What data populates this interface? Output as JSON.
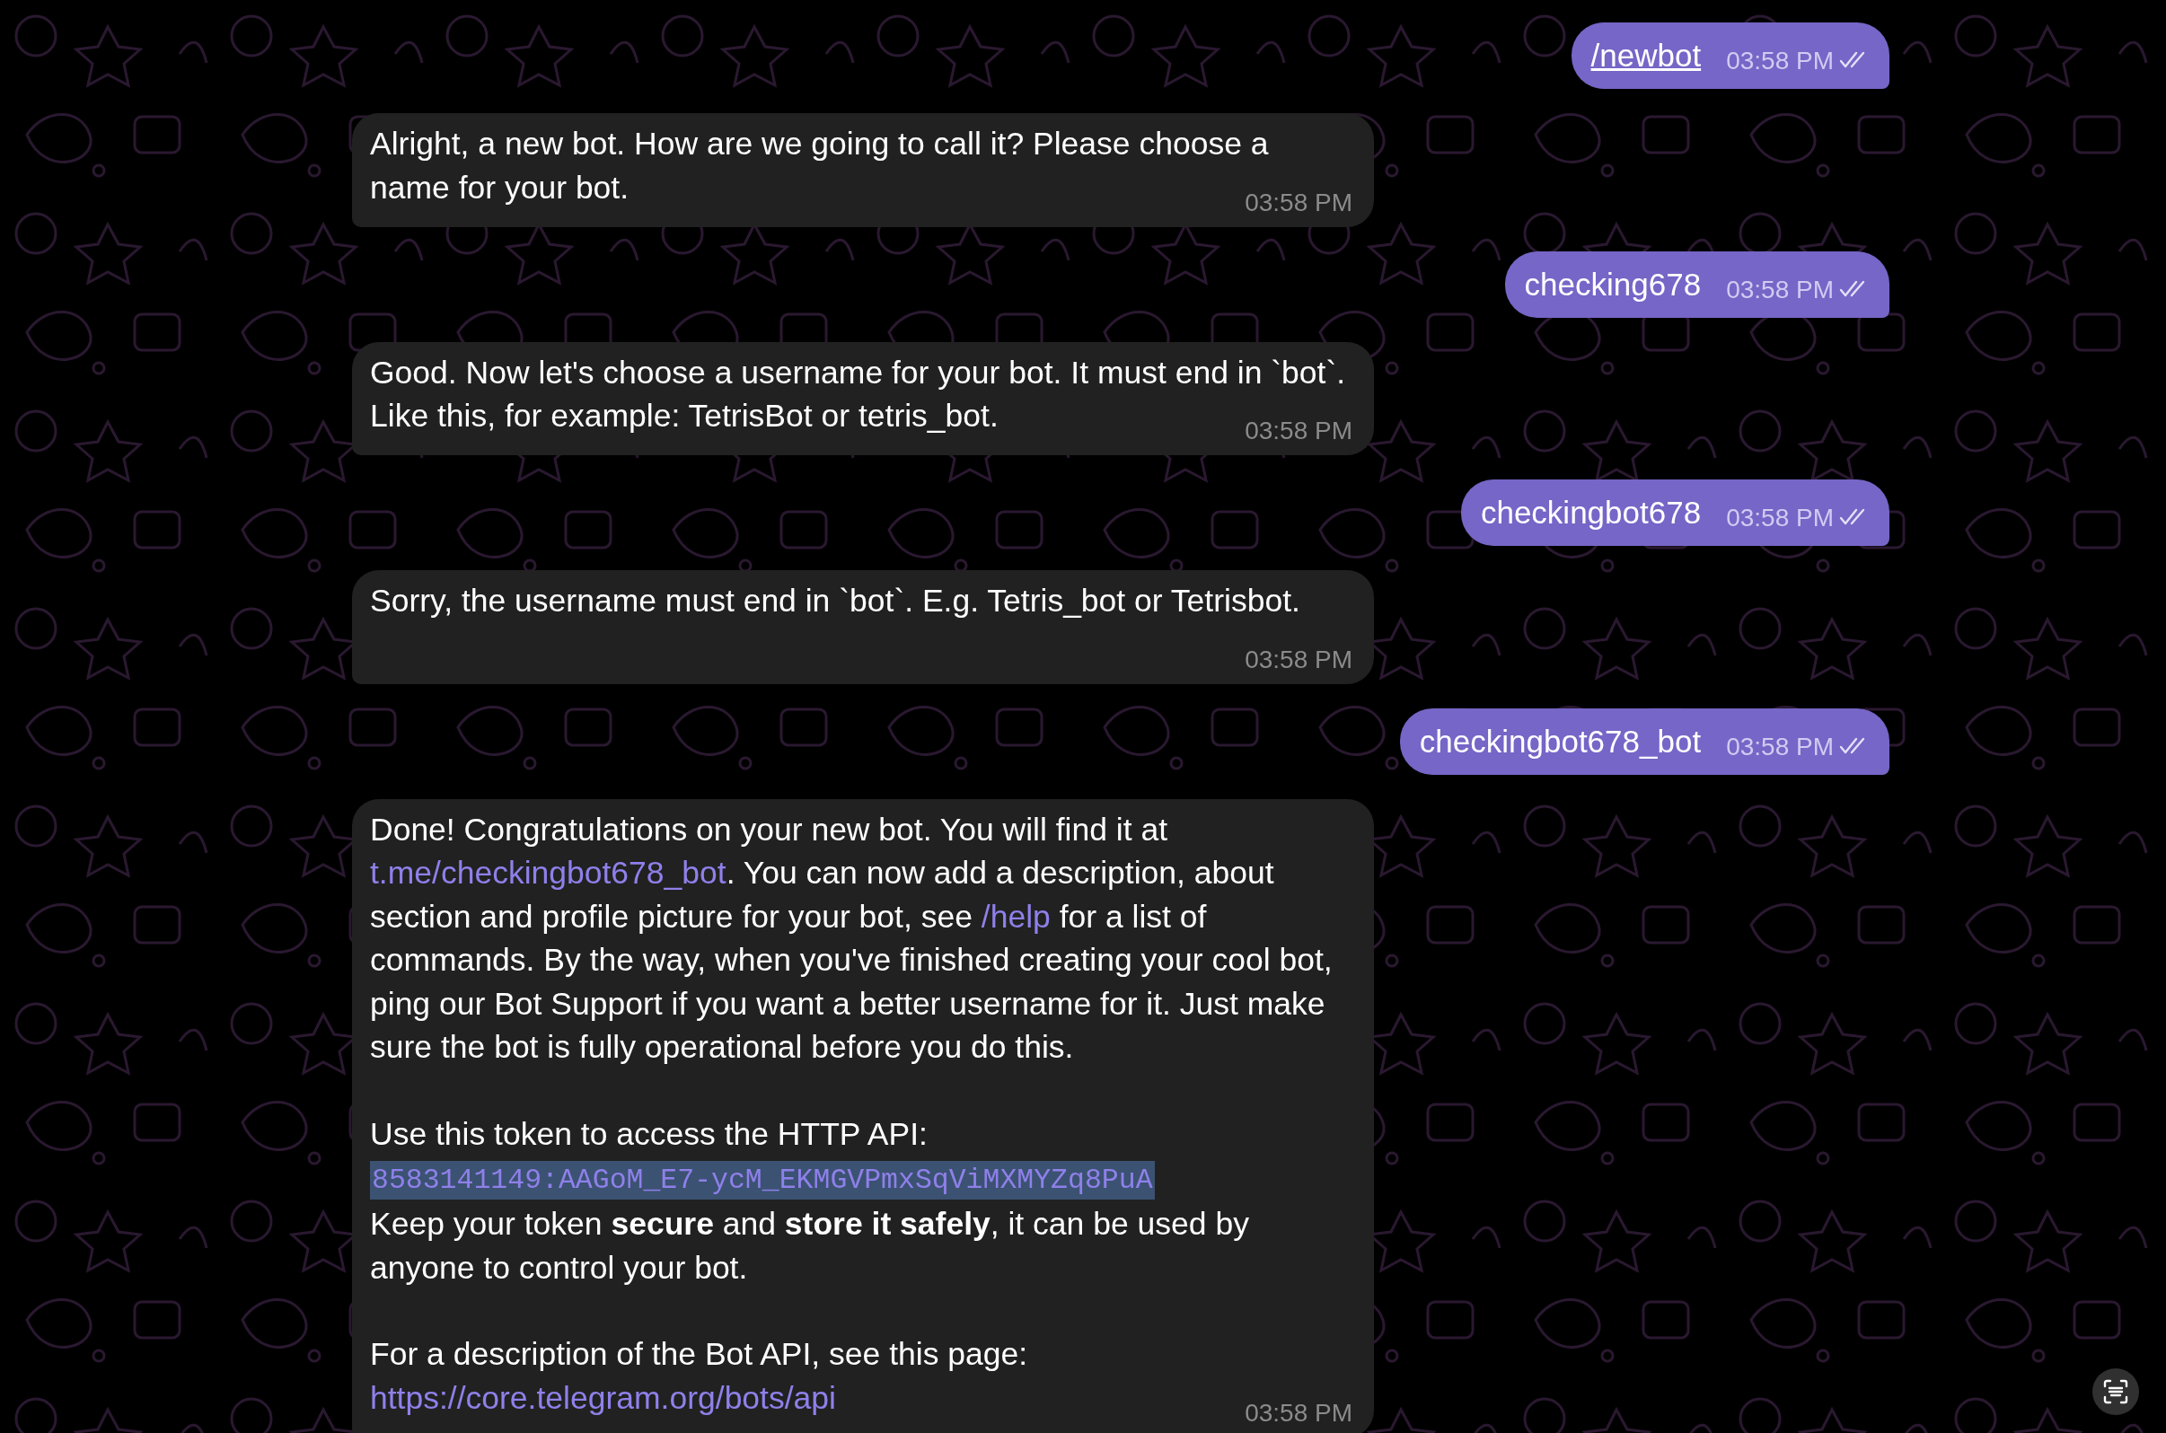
{
  "messages": [
    {
      "kind": "outgoing",
      "read": true,
      "time": "03:58 PM",
      "command": true,
      "text": "/newbot"
    },
    {
      "kind": "incoming",
      "time": "03:58 PM",
      "blocks": [
        [
          {
            "kind": "text",
            "segments": [
              {
                "kind": "plain",
                "text": "Alright, a new bot. How are we going to call it? Please choose a name for your bot."
              }
            ]
          }
        ]
      ]
    },
    {
      "kind": "outgoing",
      "read": true,
      "time": "03:58 PM",
      "command": false,
      "text": "checking678"
    },
    {
      "kind": "incoming",
      "time": "03:58 PM",
      "blocks": [
        [
          {
            "kind": "text",
            "segments": [
              {
                "kind": "plain",
                "text": "Good. Now let's choose a username for your bot. It must end in `bot`. Like this, for example: TetrisBot or tetris_bot."
              }
            ]
          }
        ]
      ]
    },
    {
      "kind": "outgoing",
      "read": true,
      "time": "03:58 PM",
      "command": false,
      "text": "checkingbot678"
    },
    {
      "kind": "incoming",
      "time": "03:58 PM",
      "blocks": [
        [
          {
            "kind": "text",
            "segments": [
              {
                "kind": "plain",
                "text": "Sorry, the username must end in `bot`. E.g. Tetris_bot or Tetrisbot."
              }
            ]
          }
        ]
      ]
    },
    {
      "kind": "outgoing",
      "read": true,
      "time": "03:58 PM",
      "command": false,
      "text": "checkingbot678_bot"
    },
    {
      "kind": "incoming",
      "time": "03:58 PM",
      "blocks": [
        [
          {
            "kind": "text",
            "segments": [
              {
                "kind": "plain",
                "text": "Done! Congratulations on your new bot. You will find it at "
              },
              {
                "kind": "link",
                "text": "t.me/checkingbot678_bot"
              },
              {
                "kind": "plain",
                "text": ". You can now add a description, about section and profile picture for your bot, see "
              },
              {
                "kind": "link",
                "text": "/help"
              },
              {
                "kind": "plain",
                "text": " for a list of commands. By the way, when you've finished creating your cool bot, ping our Bot Support if you want a better username for it. Just make sure the bot is fully operational before you do this."
              }
            ]
          }
        ],
        [
          {
            "kind": "text",
            "segments": [
              {
                "kind": "plain",
                "text": "Use this token to access the HTTP API:"
              }
            ]
          },
          {
            "kind": "code",
            "text": "8583141149:AAGoM_E7-ycM_EKMGVPmxSqViMXMYZq8PuA"
          },
          {
            "kind": "text",
            "segments": [
              {
                "kind": "plain",
                "text": "Keep your token "
              },
              {
                "kind": "bold",
                "text": "secure"
              },
              {
                "kind": "plain",
                "text": " and "
              },
              {
                "kind": "bold",
                "text": "store it safely"
              },
              {
                "kind": "plain",
                "text": ", it can be used by anyone to control your bot."
              }
            ]
          }
        ],
        [
          {
            "kind": "text",
            "segments": [
              {
                "kind": "plain",
                "text": "For a description of the Bot API, see this page: "
              },
              {
                "kind": "link",
                "text": "https://core.telegram.org/bots/api"
              }
            ]
          }
        ]
      ]
    }
  ]
}
